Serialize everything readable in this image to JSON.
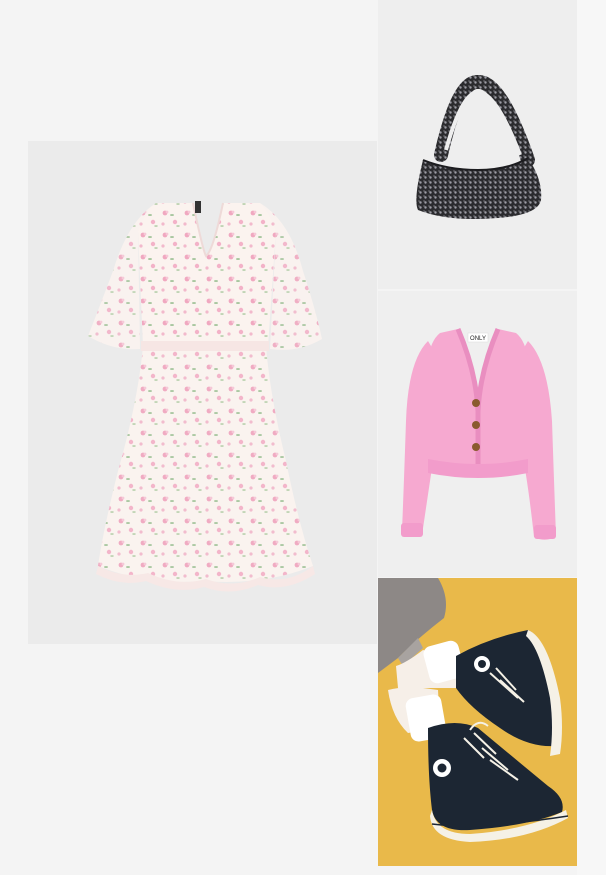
{
  "items": [
    {
      "id": "dress",
      "kind": "floral-chiffon-dress",
      "colors": {
        "base": "#fbf3ef",
        "flower_pink": "#f0a8c0",
        "flower_green": "#a9c7a0"
      }
    },
    {
      "id": "bag",
      "kind": "sequin-hobo-bag",
      "colors": {
        "base": "#2b2b2e",
        "sparkle": "#c9c9cf"
      }
    },
    {
      "id": "cardigan",
      "kind": "pink-cropped-cardigan",
      "label_text": "ONLY",
      "colors": {
        "base": "#f6a9d0",
        "shade": "#e98ec0",
        "button": "#8a5a2e"
      }
    },
    {
      "id": "shoes",
      "kind": "black-high-top-sneakers",
      "colors": {
        "background": "#e9b94a",
        "shoe": "#1c2633",
        "sole": "#f5f1e6",
        "sock": "#ffffff",
        "pants": "#8d8886"
      }
    }
  ]
}
